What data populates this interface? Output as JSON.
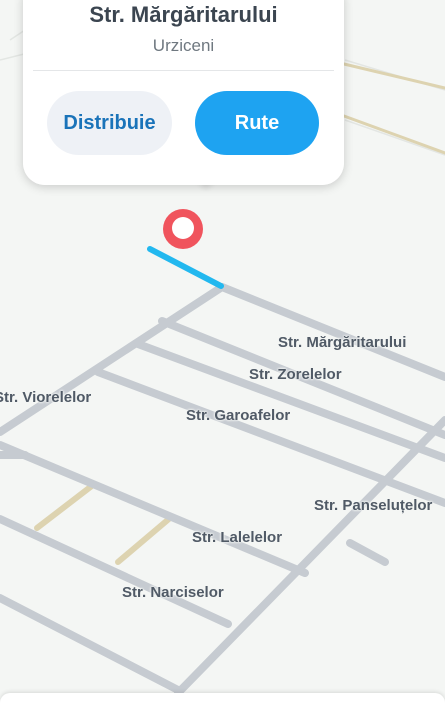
{
  "place": {
    "title": "Str. Mărgăritarului",
    "subtitle": "Urziceni"
  },
  "actions": {
    "share_label": "Distribuie",
    "route_label": "Rute"
  },
  "streets": {
    "margaritarului": "Str. Mărgăritarului",
    "zorelelor": "Str. Zorelelor",
    "viorelelor": "Str. Viorelelor",
    "garoafelor": "Str. Garoafelor",
    "panselutelor": "Str. Panseluțelor",
    "lalelelor": "Str. Lalelelor",
    "narciselor": "Str. Narciselor"
  },
  "colors": {
    "road": "#c6cbd1",
    "highlight": "#22b8ef",
    "pin": "#f0545d",
    "primary_button": "#1ea3f1",
    "minor_road": "#ddd3b0"
  },
  "icons": {
    "pin": "location-pin-icon",
    "close": "close-icon"
  }
}
